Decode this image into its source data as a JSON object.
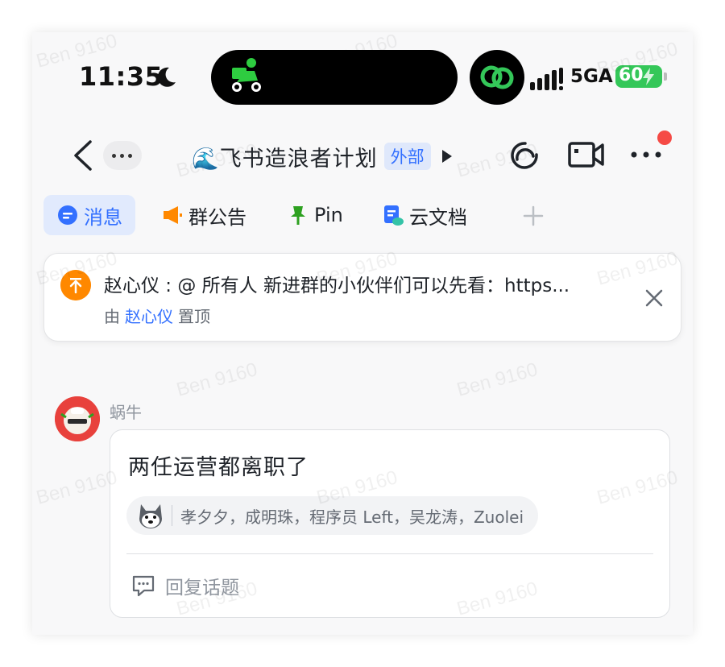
{
  "status_bar": {
    "time": "11:35",
    "network": "5GA",
    "battery": "60"
  },
  "nav": {
    "group_title": "🌊飞书造浪者计划",
    "external_badge": "外部"
  },
  "tabs": [
    {
      "label": "消息",
      "icon": "chat-bubble-icon",
      "color": "#3370ff"
    },
    {
      "label": "群公告",
      "icon": "megaphone-icon",
      "color": "#ff8800"
    },
    {
      "label": "Pin",
      "icon": "pin-icon",
      "color": "#2ea121"
    },
    {
      "label": "云文档",
      "icon": "cloud-doc-icon",
      "color": "#3370ff"
    }
  ],
  "pinned": {
    "text": "赵心仪 : @ 所有人  新进群的小伙伴们可以先看：https...",
    "by_prefix": "由",
    "by_user": "赵心仪",
    "by_suffix": "置顶"
  },
  "message": {
    "sender": "蜗牛",
    "text": "两任运营都离职了",
    "reaction_users": "孝夕夕，成明珠，程序员 Left，吴龙涛，Zuolei",
    "reply_label": "回复话题"
  },
  "watermark": "Ben 9160",
  "colors": {
    "accent": "#3370ff",
    "battery": "#34c759",
    "notification_dot": "#f54a45",
    "pin_avatar": "#ff8800"
  }
}
